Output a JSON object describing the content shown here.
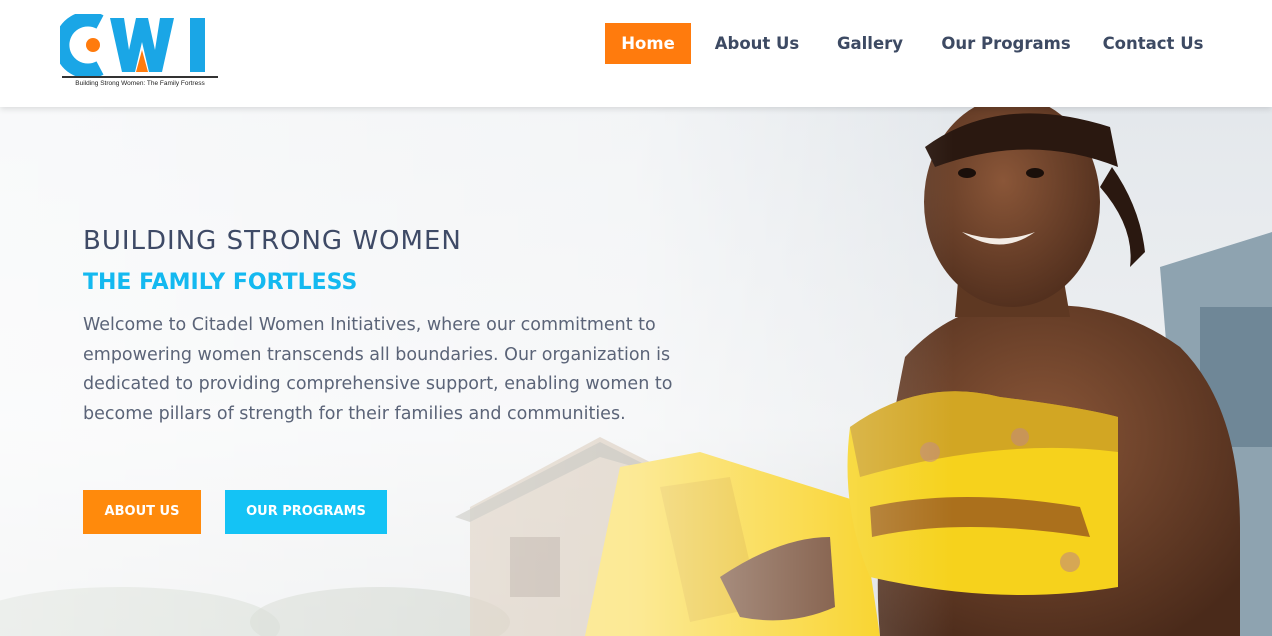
{
  "header": {
    "logo": {
      "letters": "CWI",
      "tagline": "Building Strong Women: The Family Fortress",
      "colors": {
        "primary": "#1aa6e6",
        "accent": "#ff7b0d"
      }
    },
    "nav": [
      {
        "label": "Home",
        "active": true
      },
      {
        "label": "About Us",
        "active": false
      },
      {
        "label": "Gallery",
        "active": false
      },
      {
        "label": "Our Programs",
        "active": false
      },
      {
        "label": "Contact Us",
        "active": false
      }
    ]
  },
  "hero": {
    "title": "BUILDING STRONG WOMEN",
    "subtitle": "THE FAMILY FORTLESS",
    "body": "Welcome to Citadel Women Initiatives, where our commitment to empowering women transcends all boundaries. Our organization is dedicated to providing comprehensive support, enabling women to become pillars of strength for their families and communities.",
    "buttons": {
      "about_label": "ABOUT US",
      "programs_label": "OUR PROGRAMS"
    },
    "image": "smiling woman in yellow patterned top holding a yellow jerrycan"
  },
  "theme": {
    "accent_orange": "#ff7b0d",
    "accent_blue": "#14c3f5",
    "text_dark": "#3e4a66"
  }
}
